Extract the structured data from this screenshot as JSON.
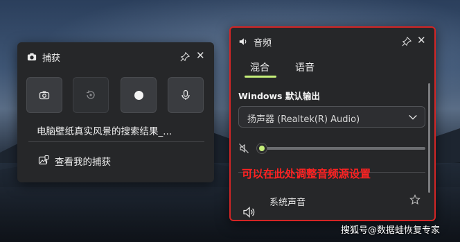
{
  "capture": {
    "title": "捕获",
    "header_icon": "camera-icon",
    "buttons": [
      {
        "name": "screenshot",
        "icon": "camera-icon"
      },
      {
        "name": "recent-recording",
        "icon": "replay-icon"
      },
      {
        "name": "record",
        "icon": "record-dot-icon"
      },
      {
        "name": "microphone",
        "icon": "microphone-icon"
      }
    ],
    "caption": "电脑壁纸真实风景的搜索结果_...",
    "gallery_link": "查看我的捕获"
  },
  "audio": {
    "title": "音频",
    "tabs": [
      {
        "label": "混合",
        "active": true
      },
      {
        "label": "语音",
        "active": false
      }
    ],
    "output_label": "Windows 默认输出",
    "device": "扬声器 (Realtek(R) Audio)",
    "volume_fraction": 0.0,
    "annotation": "可以在此处调整音频源设置",
    "app_item": "系统声音"
  },
  "colors": {
    "accent": "#c6f07a",
    "highlight_border": "#d42525",
    "annotation": "#ff2222"
  },
  "watermark": "搜狐号@数据蛙恢复专家"
}
